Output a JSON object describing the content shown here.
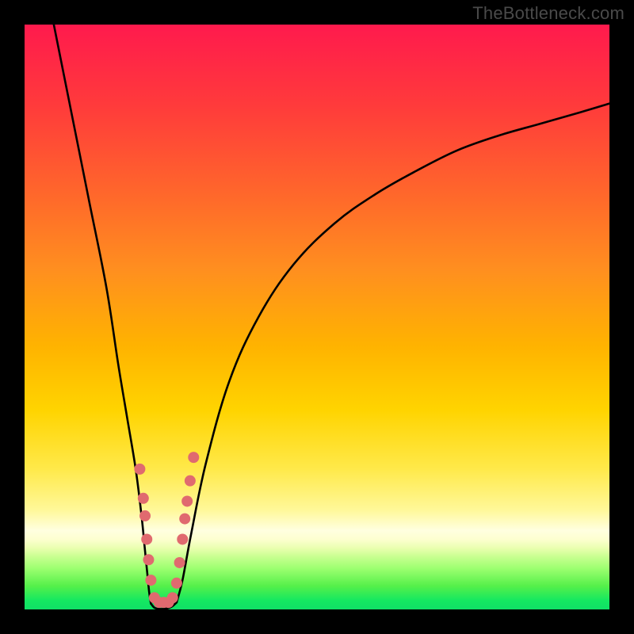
{
  "watermark": "TheBottleneck.com",
  "chart_data": {
    "type": "line",
    "title": "",
    "xlabel": "",
    "ylabel": "",
    "xlim": [
      0,
      100
    ],
    "ylim": [
      0,
      100
    ],
    "series": [
      {
        "name": "left-branch",
        "x": [
          5,
          8,
          11,
          14,
          16,
          17.5,
          19,
          20,
          20.5,
          21,
          21.3,
          21.6
        ],
        "y": [
          100,
          85,
          70,
          55,
          42,
          33,
          24,
          16,
          11,
          6,
          3,
          1
        ]
      },
      {
        "name": "valley-floor",
        "x": [
          21.6,
          22.2,
          23.0,
          23.8,
          24.5,
          25.2,
          26.0
        ],
        "y": [
          1,
          0.3,
          0.1,
          0.1,
          0.2,
          0.5,
          1.2
        ]
      },
      {
        "name": "right-branch",
        "x": [
          26.0,
          27.0,
          28.5,
          31,
          35,
          40,
          46,
          53,
          60,
          67,
          74,
          81,
          88,
          95,
          100
        ],
        "y": [
          1.2,
          5,
          13,
          25,
          39,
          50,
          59,
          66,
          71,
          75,
          78.5,
          81,
          83,
          85,
          86.5
        ]
      }
    ],
    "markers": {
      "name": "cluster-dots",
      "points": [
        {
          "x": 19.7,
          "y": 24
        },
        {
          "x": 20.3,
          "y": 19
        },
        {
          "x": 20.6,
          "y": 16
        },
        {
          "x": 20.9,
          "y": 12
        },
        {
          "x": 21.2,
          "y": 8.5
        },
        {
          "x": 21.6,
          "y": 5
        },
        {
          "x": 22.2,
          "y": 2
        },
        {
          "x": 23.0,
          "y": 1.2
        },
        {
          "x": 23.8,
          "y": 1.2
        },
        {
          "x": 24.6,
          "y": 1.2
        },
        {
          "x": 25.3,
          "y": 2.0
        },
        {
          "x": 26.0,
          "y": 4.5
        },
        {
          "x": 26.5,
          "y": 8.0
        },
        {
          "x": 27.0,
          "y": 12.0
        },
        {
          "x": 27.4,
          "y": 15.5
        },
        {
          "x": 27.8,
          "y": 18.5
        },
        {
          "x": 28.3,
          "y": 22.0
        },
        {
          "x": 28.9,
          "y": 26.0
        }
      ],
      "radius": 7
    },
    "background": {
      "type": "vertical-gradient",
      "stops": [
        {
          "pos": 0.0,
          "color": "#ff1a4d"
        },
        {
          "pos": 0.3,
          "color": "#ff6a2a"
        },
        {
          "pos": 0.55,
          "color": "#ffb300"
        },
        {
          "pos": 0.76,
          "color": "#ffe94a"
        },
        {
          "pos": 0.88,
          "color": "#fdffd0"
        },
        {
          "pos": 0.93,
          "color": "#9cff70"
        },
        {
          "pos": 1.0,
          "color": "#10e066"
        }
      ]
    }
  }
}
